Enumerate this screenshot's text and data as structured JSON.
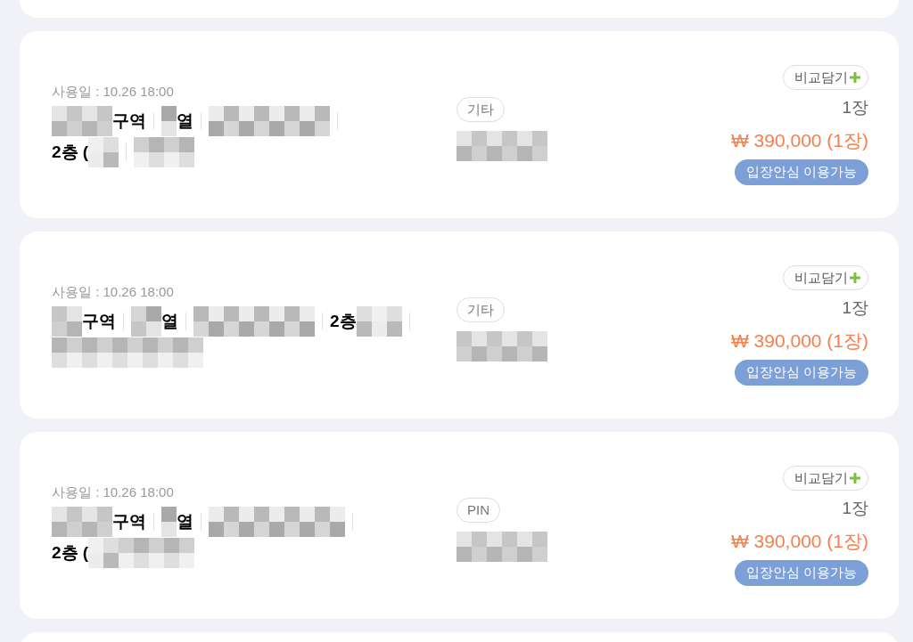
{
  "tickets": [
    {
      "date": "사용일 : 10.26 18:00",
      "seat_lines": [
        [
          {
            "kind": "redacted"
          },
          {
            "kind": "text",
            "text": "구역"
          },
          {
            "kind": "sep"
          },
          {
            "kind": "redacted"
          },
          {
            "kind": "text",
            "text": "열"
          },
          {
            "kind": "sep"
          },
          {
            "kind": "redacted"
          },
          {
            "kind": "sep"
          }
        ],
        [
          {
            "kind": "text",
            "text": "2층 ("
          },
          {
            "kind": "redacted"
          },
          {
            "kind": "sep"
          },
          {
            "kind": "redacted"
          }
        ]
      ],
      "tag": "기타",
      "compare": "비교담기",
      "quantity": "1장",
      "price": "₩ 390,000 (1장)",
      "badge": "입장안심 이용가능"
    },
    {
      "date": "사용일 : 10.26 18:00",
      "seat_lines": [
        [
          {
            "kind": "redacted"
          },
          {
            "kind": "text",
            "text": "구역"
          },
          {
            "kind": "sep"
          },
          {
            "kind": "redacted"
          },
          {
            "kind": "text",
            "text": "열"
          },
          {
            "kind": "sep"
          },
          {
            "kind": "redacted"
          },
          {
            "kind": "sep"
          },
          {
            "kind": "text",
            "text": "2층"
          },
          {
            "kind": "redacted"
          },
          {
            "kind": "sep"
          }
        ],
        [
          {
            "kind": "redacted"
          }
        ]
      ],
      "tag": "기타",
      "compare": "비교담기",
      "quantity": "1장",
      "price": "₩ 390,000 (1장)",
      "badge": "입장안심 이용가능"
    },
    {
      "date": "사용일 : 10.26 18:00",
      "seat_lines": [
        [
          {
            "kind": "redacted"
          },
          {
            "kind": "text",
            "text": "구역"
          },
          {
            "kind": "sep"
          },
          {
            "kind": "redacted"
          },
          {
            "kind": "text",
            "text": "열"
          },
          {
            "kind": "sep"
          },
          {
            "kind": "redacted"
          },
          {
            "kind": "sep"
          }
        ],
        [
          {
            "kind": "text",
            "text": "2층 ("
          },
          {
            "kind": "redacted"
          },
          {
            "kind": "redacted"
          }
        ]
      ],
      "tag": "PIN",
      "compare": "비교담기",
      "quantity": "1장",
      "price": "₩ 390,000 (1장)",
      "badge": "입장안심 이용가능"
    }
  ]
}
